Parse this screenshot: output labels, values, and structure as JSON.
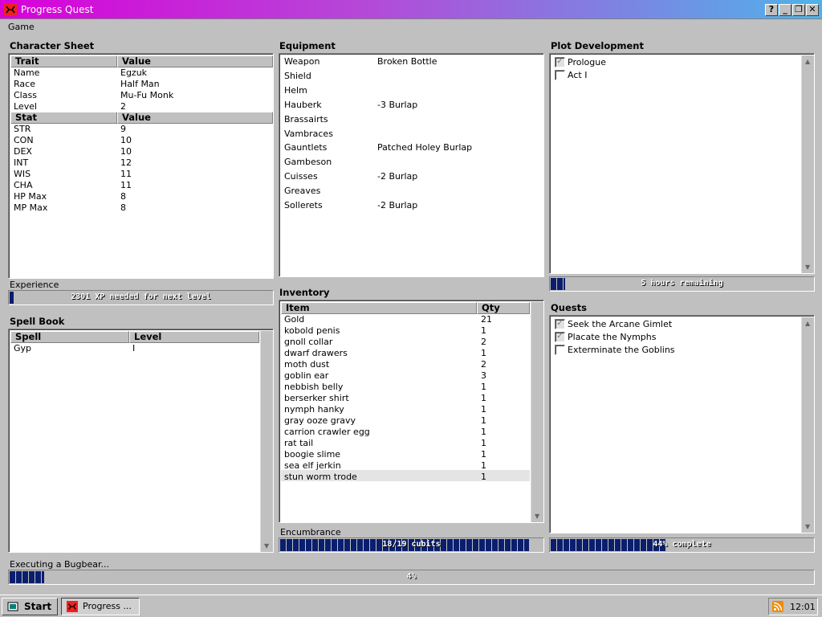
{
  "window": {
    "title": "Progress Quest",
    "help": "?",
    "minimize": "_",
    "restore": "❐",
    "close": "✕"
  },
  "menu": {
    "game": "Game"
  },
  "character_sheet": {
    "title": "Character Sheet",
    "trait_header": "Trait",
    "value_header": "Value",
    "traits": [
      {
        "k": "Name",
        "v": "Egzuk"
      },
      {
        "k": "Race",
        "v": "Half Man"
      },
      {
        "k": "Class",
        "v": "Mu-Fu Monk"
      },
      {
        "k": "Level",
        "v": "2"
      }
    ],
    "stat_header": "Stat",
    "stat_value_header": "Value",
    "stats": [
      {
        "k": "STR",
        "v": "9"
      },
      {
        "k": "CON",
        "v": "10"
      },
      {
        "k": "DEX",
        "v": "10"
      },
      {
        "k": "INT",
        "v": "12"
      },
      {
        "k": "WIS",
        "v": "11"
      },
      {
        "k": "CHA",
        "v": "11"
      },
      {
        "k": "HP Max",
        "v": "8"
      },
      {
        "k": "MP Max",
        "v": "8"
      }
    ]
  },
  "experience": {
    "label": "Experience",
    "text": "2301 XP needed for next level",
    "progress": 0.02
  },
  "spell_book": {
    "title": "Spell Book",
    "spell_header": "Spell",
    "level_header": "Level",
    "spells": [
      {
        "name": "Gyp",
        "level": "I"
      }
    ]
  },
  "equipment": {
    "title": "Equipment",
    "items": [
      {
        "slot": "Weapon",
        "item": "Broken Bottle"
      },
      {
        "slot": "Shield",
        "item": ""
      },
      {
        "slot": "Helm",
        "item": ""
      },
      {
        "slot": "Hauberk",
        "item": "-3 Burlap"
      },
      {
        "slot": "Brassairts",
        "item": ""
      },
      {
        "slot": "Vambraces",
        "item": ""
      },
      {
        "slot": "Gauntlets",
        "item": "Patched Holey Burlap"
      },
      {
        "slot": "Gambeson",
        "item": ""
      },
      {
        "slot": "Cuisses",
        "item": "-2 Burlap"
      },
      {
        "slot": "Greaves",
        "item": ""
      },
      {
        "slot": "Sollerets",
        "item": "-2 Burlap"
      }
    ]
  },
  "inventory": {
    "title": "Inventory",
    "item_header": "Item",
    "qty_header": "Qty",
    "items": [
      {
        "name": "Gold",
        "qty": "21"
      },
      {
        "name": "kobold penis",
        "qty": "1"
      },
      {
        "name": "gnoll collar",
        "qty": "2"
      },
      {
        "name": "dwarf drawers",
        "qty": "1"
      },
      {
        "name": "moth dust",
        "qty": "2"
      },
      {
        "name": "goblin ear",
        "qty": "3"
      },
      {
        "name": "nebbish belly",
        "qty": "1"
      },
      {
        "name": "berserker shirt",
        "qty": "1"
      },
      {
        "name": "nymph hanky",
        "qty": "1"
      },
      {
        "name": "gray ooze gravy",
        "qty": "1"
      },
      {
        "name": "carrion crawler egg",
        "qty": "1"
      },
      {
        "name": "rat tail",
        "qty": "1"
      },
      {
        "name": "boogie slime",
        "qty": "1"
      },
      {
        "name": "sea elf jerkin",
        "qty": "1"
      },
      {
        "name": "stun worm trode",
        "qty": "1"
      }
    ]
  },
  "encumbrance": {
    "label": "Encumbrance",
    "text": "18/19 cubits",
    "progress": 0.947
  },
  "plot": {
    "title": "Plot Development",
    "acts": [
      {
        "name": "Prologue",
        "done": true
      },
      {
        "name": "Act I",
        "done": false
      }
    ],
    "progress_text": "5 hours remaining",
    "progress": 0.06
  },
  "quests": {
    "title": "Quests",
    "items": [
      {
        "name": "Seek the Arcane Gimlet",
        "done": true
      },
      {
        "name": "Placate the Nymphs",
        "done": true
      },
      {
        "name": "Exterminate the Goblins",
        "done": false
      }
    ],
    "progress_text": "44% complete",
    "progress": 0.44
  },
  "task": {
    "label": "Executing a Bugbear...",
    "text": "4%",
    "progress": 0.045
  },
  "taskbar": {
    "start": "Start",
    "task": "Progress ...",
    "clock": "12:01"
  },
  "check_mark": "✓",
  "up_arrow": "▲",
  "down_arrow": "▼",
  "colors": {
    "progress_fill": "#0a1e6e",
    "title_left": "#d800d8",
    "title_right": "#4fb3ea"
  }
}
